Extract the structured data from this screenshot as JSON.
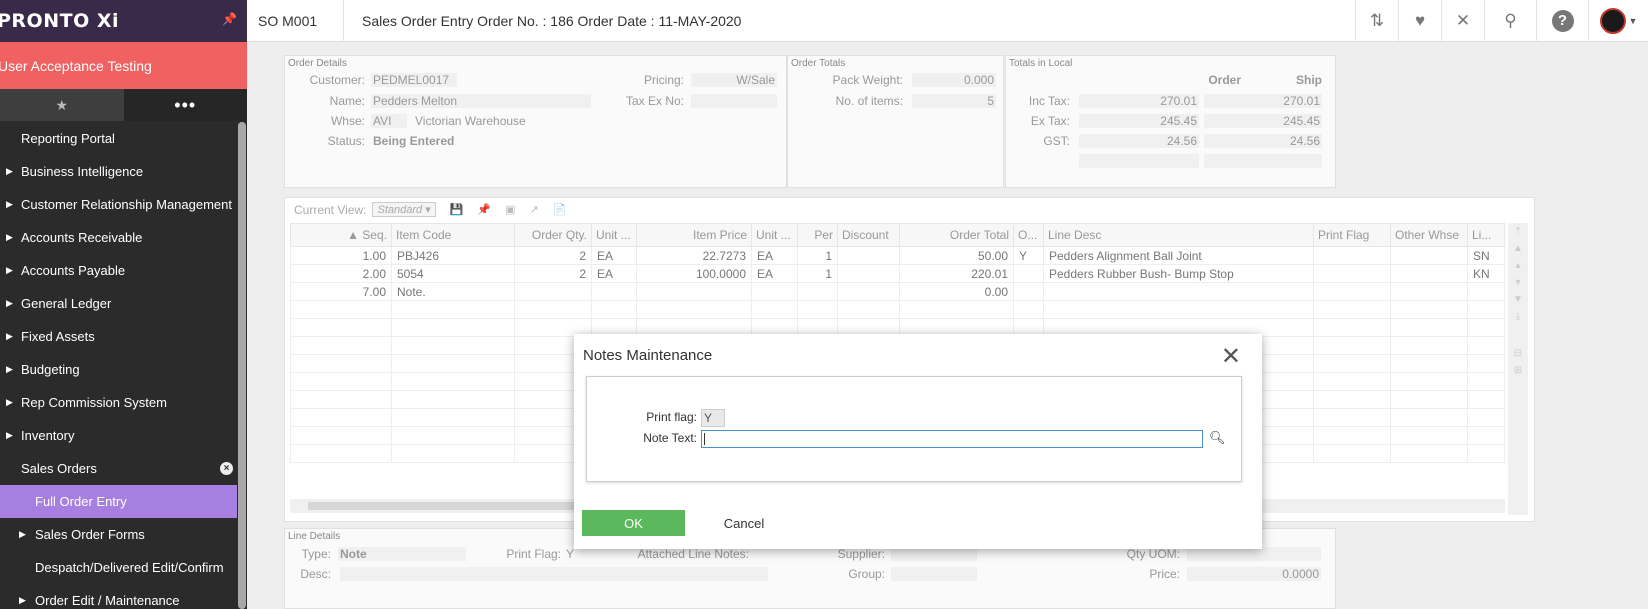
{
  "brand": {
    "logo": "PRONTO Xi",
    "pin_icon": "pin-icon"
  },
  "environment": "User Acceptance Testing",
  "sidebar_tabs": {
    "favorites_icon": "★",
    "more_icon": "•••"
  },
  "menu": [
    {
      "label": "Reporting Portal",
      "arrow": false
    },
    {
      "label": "Business Intelligence",
      "arrow": true
    },
    {
      "label": "Customer Relationship Management",
      "arrow": true
    },
    {
      "label": "Accounts Receivable",
      "arrow": true
    },
    {
      "label": "Accounts Payable",
      "arrow": true
    },
    {
      "label": "General Ledger",
      "arrow": true
    },
    {
      "label": "Fixed Assets",
      "arrow": true
    },
    {
      "label": "Budgeting",
      "arrow": true
    },
    {
      "label": "Rep Commission System",
      "arrow": true
    },
    {
      "label": "Inventory",
      "arrow": true
    },
    {
      "label": "Sales Orders",
      "arrow": false,
      "badge": "×"
    },
    {
      "label": "Full Order Entry",
      "sub": true,
      "active": true
    },
    {
      "label": "Sales Order Forms",
      "sub": true,
      "arrow": true
    },
    {
      "label": "Despatch/Delivered Edit/Confirm",
      "sub": true
    },
    {
      "label": "Order Edit / Maintenance",
      "sub": true,
      "arrow": true
    }
  ],
  "header": {
    "code": "SO M001",
    "title": "Sales Order Entry Order No. : 186 Order Date : 11-MAY-2020"
  },
  "order_details": {
    "title": "Order Details",
    "customer_label": "Customer:",
    "customer": "PEDMEL0017",
    "name_label": "Name:",
    "name": "Pedders Melton",
    "whse_label": "Whse:",
    "whse_code": "AVI",
    "whse_name": "Victorian Warehouse",
    "status_label": "Status:",
    "status": "Being Entered",
    "pricing_label": "Pricing:",
    "pricing": "W/Sale",
    "taxex_label": "Tax Ex No:",
    "taxex": ""
  },
  "order_totals": {
    "title": "Order Totals",
    "pack_weight_label": "Pack Weight:",
    "pack_weight": "0.000",
    "items_label": "No. of items:",
    "items": "5"
  },
  "totals_local": {
    "title": "Totals in Local",
    "col_order": "Order",
    "col_ship": "Ship",
    "inc_tax_label": "Inc Tax:",
    "inc_tax_order": "270.01",
    "inc_tax_ship": "270.01",
    "ex_tax_label": "Ex Tax:",
    "ex_tax_order": "245.45",
    "ex_tax_ship": "245.45",
    "gst_label": "GST:",
    "gst_order": "24.56",
    "gst_ship": "24.56"
  },
  "grid": {
    "view_label": "Current View:",
    "view_value": "Standard",
    "columns": [
      "▲ Seq.",
      "Item Code",
      "Order Qty.",
      "Unit ...",
      "Item Price",
      "Unit ...",
      "Per",
      "Discount",
      "Order Total",
      "O...",
      "Line Desc",
      "Print Flag",
      "Other Whse",
      "Li..."
    ],
    "rows": [
      [
        "1.00",
        "PBJ426",
        "2",
        "EA",
        "22.7273",
        "EA",
        "1",
        "",
        "50.00",
        "Y",
        "Pedders Alignment Ball Joint",
        "",
        "",
        "SN"
      ],
      [
        "2.00",
        "5054",
        "2",
        "EA",
        "100.0000",
        "EA",
        "1",
        "",
        "220.01",
        "",
        "Pedders Rubber Bush- Bump Stop",
        "",
        "",
        "KN"
      ],
      [
        "7.00",
        "Note.",
        "",
        "",
        "",
        "",
        "",
        "",
        "0.00",
        "",
        "",
        "",
        "",
        ""
      ]
    ]
  },
  "line_details": {
    "title": "Line Details",
    "type_label": "Type:",
    "type": "Note",
    "print_flag_label": "Print Flag:",
    "print_flag": "Y",
    "attached_label": "Attached Line Notes:",
    "supplier_label": "Supplier:",
    "qty_uom_label": "Qty UOM:",
    "desc_label": "Desc:",
    "group_label": "Group:",
    "price_label": "Price:",
    "price": "0.0000"
  },
  "modal": {
    "title": "Notes Maintenance",
    "print_flag_label": "Print flag:",
    "print_flag": "Y",
    "note_text_label": "Note Text:",
    "note_text": "",
    "ok": "OK",
    "cancel": "Cancel"
  }
}
